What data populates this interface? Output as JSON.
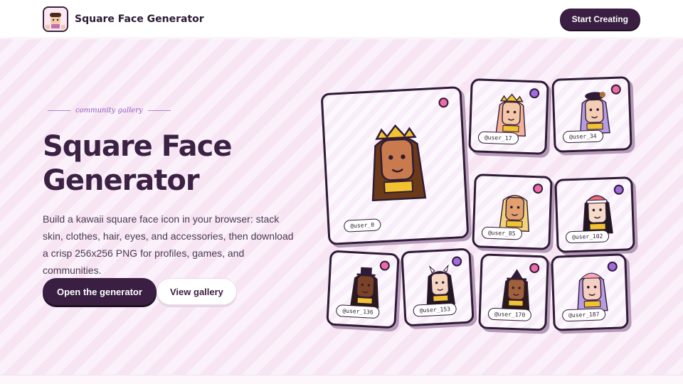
{
  "header": {
    "brand": "Square Face Generator",
    "cta": "Start Creating"
  },
  "hero": {
    "eyebrow": "community gallery",
    "title": "Square Face Generator",
    "description": "Build a kawaii square face icon in your browser: stack skin, clothes, hair, eyes, and accessories, then download a crisp 256x256 PNG for profiles, games, and communities.",
    "primary_button": "Open the generator",
    "secondary_button": "View gallery"
  },
  "gallery": [
    {
      "user": "@user_0",
      "dot": "#f06aa8",
      "skin": "#c97b4d",
      "hair": "#6b3a18",
      "hat": "crown"
    },
    {
      "user": "@user_17",
      "dot": "#a26be0",
      "skin": "#f4c7a6",
      "hair": "#f2b39a",
      "hat": "crown"
    },
    {
      "user": "@user_34",
      "dot": "#f06aa8",
      "skin": "#f4cdb5",
      "hair": "#b79ce0",
      "hat": "beret"
    },
    {
      "user": "@user_85",
      "dot": "#f06aa8",
      "skin": "#e2a06e",
      "hair": "#f3d37a",
      "hat": "none"
    },
    {
      "user": "@user_102",
      "dot": "#a26be0",
      "skin": "#f6dcc8",
      "hair": "#231722",
      "hat": "beanie"
    },
    {
      "user": "@user_136",
      "dot": "#f06aa8",
      "skin": "#7a4327",
      "hair": "#2c1a1a",
      "hat": "tophat"
    },
    {
      "user": "@user_153",
      "dot": "#a26be0",
      "skin": "#f5d6c3",
      "hair": "#231722",
      "hat": "horns"
    },
    {
      "user": "@user_170",
      "dot": "#f06aa8",
      "skin": "#a0603a",
      "hair": "#2c1a1a",
      "hat": "witch"
    },
    {
      "user": "@user_187",
      "dot": "#a26be0",
      "skin": "#f5cfbf",
      "hair": "#b79ce0",
      "hat": "cap"
    }
  ]
}
